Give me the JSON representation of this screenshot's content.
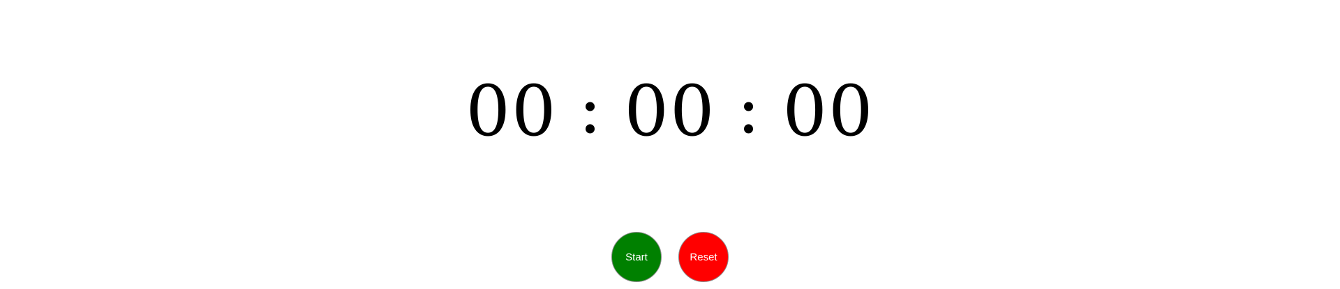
{
  "timer": {
    "hours": "00",
    "minutes": "00",
    "seconds": "00",
    "separator": ":"
  },
  "controls": {
    "start_label": "Start",
    "reset_label": "Reset"
  },
  "colors": {
    "start": "#008000",
    "reset": "#ff0000",
    "text": "#000000",
    "background": "#ffffff"
  }
}
